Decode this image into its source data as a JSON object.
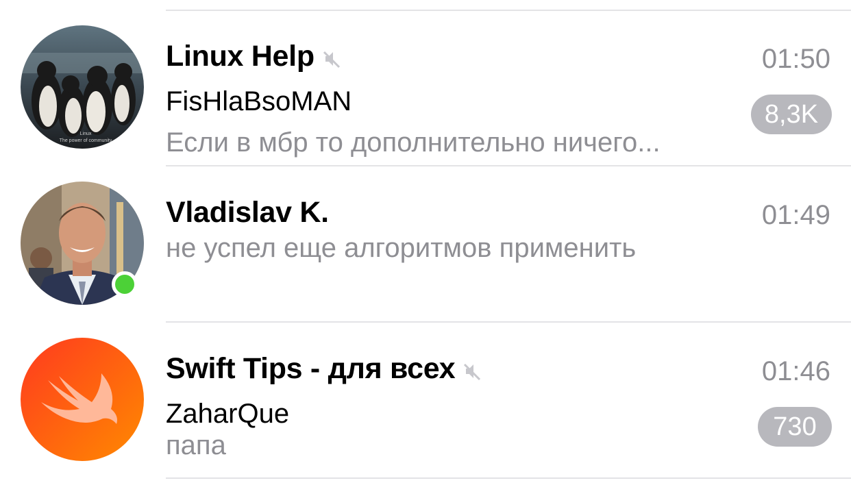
{
  "chats": [
    {
      "title": "Linux Help",
      "time": "01:50",
      "sender": "FisHlaBsoMAN",
      "preview": "Если в мбр то дополнительно ничего...",
      "unread": "8,3K",
      "muted": true,
      "avatar_caption_1": "Linux",
      "avatar_caption_2": "The power of community"
    },
    {
      "title": "Vladislav K.",
      "time": "01:49",
      "preview": "не успел еще алгоритмов применить",
      "online": true
    },
    {
      "title": "Swift Tips - для всех",
      "time": "01:46",
      "sender": "ZaharQue",
      "preview": "папа",
      "unread": "730",
      "muted": true
    }
  ],
  "colors": {
    "secondary_text": "#8e8e93",
    "badge_muted": "#b8b8bd",
    "separator": "#e3e3e6",
    "online": "#4cd137",
    "swift_gradient_start": "#ff3b1f",
    "swift_gradient_end": "#ff8a00"
  },
  "icons": {
    "mute": "speaker-muted-icon",
    "swift": "swift-bird-icon"
  }
}
